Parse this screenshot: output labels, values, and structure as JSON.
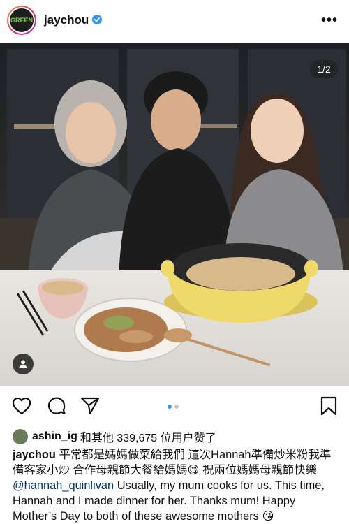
{
  "post": {
    "username": "jaychou",
    "avatar_text": "GREEN",
    "more_label": "•••",
    "image_counter": "1/2",
    "carousel": {
      "total": 2,
      "current": 1
    }
  },
  "likes": {
    "first_user": "ashin_ig",
    "text": "和其他 339,675 位用户赞了"
  },
  "caption": {
    "username": "jaychou",
    "part1": " 平常都是媽媽做菜給我們 這次Hannah準備炒米粉我準備客家小炒 合作母親節大餐給媽媽",
    "emoji1": "😋",
    "part2": " 祝兩位媽媽母親節快樂 ",
    "mention": "@hannah_quinlivan",
    "part3": " Usually, my mum cooks for us. This time, Hannah and I made dinner for her. Thanks mum! Happy Mother’s Day to both of these awesome mothers ",
    "emoji2": "😘"
  },
  "colors": {
    "accent_blue": "#3897f0",
    "verified_blue": "#3897f0",
    "mention": "#003569"
  }
}
